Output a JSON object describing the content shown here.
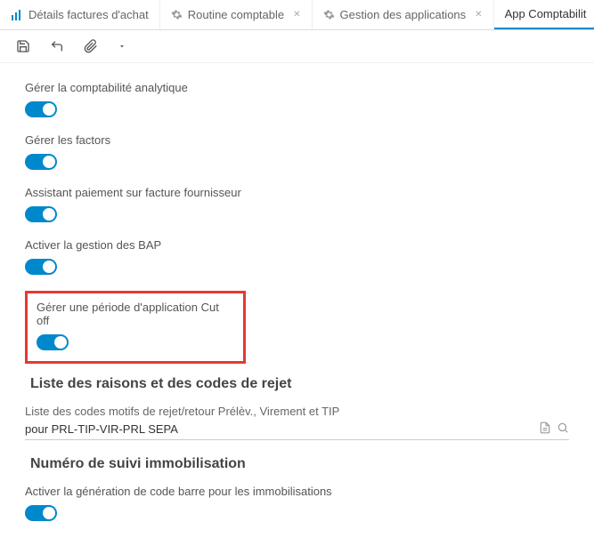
{
  "tabs": [
    {
      "label": "Détails factures d'achat",
      "icon": "bar-chart-icon",
      "closable": false,
      "active": false
    },
    {
      "label": "Routine comptable",
      "icon": "gear-icon",
      "closable": true,
      "active": false
    },
    {
      "label": "Gestion des applications",
      "icon": "gear-icon",
      "closable": true,
      "active": false
    },
    {
      "label": "App Comptabilit",
      "icon": "",
      "closable": false,
      "active": true
    }
  ],
  "settings": {
    "analytic": {
      "label": "Gérer la comptabilité analytique",
      "on": true
    },
    "factors": {
      "label": "Gérer les factors",
      "on": true
    },
    "assistant": {
      "label": "Assistant paiement sur facture fournisseur",
      "on": true
    },
    "bap": {
      "label": "Activer la gestion des BAP",
      "on": true
    },
    "cutoff": {
      "label": "Gérer une période d'application Cut off",
      "on": true
    }
  },
  "rejection": {
    "title": "Liste des raisons et des codes de rejet",
    "field_label": "Liste des codes motifs de rejet/retour Prélèv., Virement et TIP",
    "field_value": "pour PRL-TIP-VIR-PRL SEPA"
  },
  "immobilisation": {
    "title": "Numéro de suivi immobilisation",
    "barcode": {
      "label": "Activer la génération de code barre pour les immobilisations",
      "on": true
    }
  }
}
